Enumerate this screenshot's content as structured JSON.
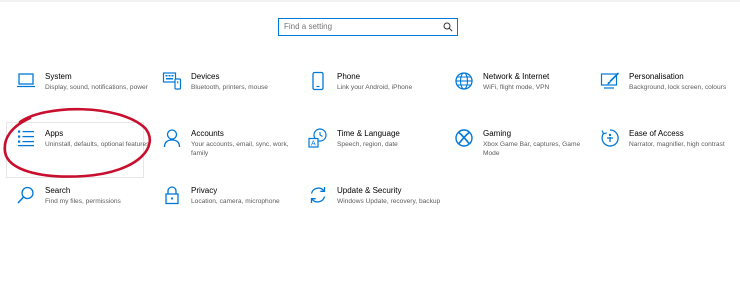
{
  "search": {
    "placeholder": "Find a setting"
  },
  "accent_color": "#0078d7",
  "annotation_color": "#c8102e",
  "tiles": [
    {
      "icon": "laptop-icon",
      "title": "System",
      "desc": "Display, sound, notifications, power"
    },
    {
      "icon": "devices-icon",
      "title": "Devices",
      "desc": "Bluetooth, printers, mouse"
    },
    {
      "icon": "phone-icon",
      "title": "Phone",
      "desc": "Link your Android, iPhone"
    },
    {
      "icon": "globe-icon",
      "title": "Network & Internet",
      "desc": "WiFi, flight mode, VPN"
    },
    {
      "icon": "paintbrush-icon",
      "title": "Personalisation",
      "desc": "Background, lock screen, colours"
    },
    {
      "icon": "apps-list-icon",
      "title": "Apps",
      "desc": "Uninstall, defaults, optional features"
    },
    {
      "icon": "person-icon",
      "title": "Accounts",
      "desc": "Your accounts, email, sync, work, family"
    },
    {
      "icon": "time-language-icon",
      "title": "Time & Language",
      "desc": "Speech, region, date"
    },
    {
      "icon": "xbox-icon",
      "title": "Gaming",
      "desc": "Xbox Game Bar, captures, Game Mode"
    },
    {
      "icon": "ease-of-access-icon",
      "title": "Ease of Access",
      "desc": "Narrator, magnifier, high contrast"
    },
    {
      "icon": "search-icon",
      "title": "Search",
      "desc": "Find my files, permissions"
    },
    {
      "icon": "lock-icon",
      "title": "Privacy",
      "desc": "Location, camera, microphone"
    },
    {
      "icon": "sync-icon",
      "title": "Update & Security",
      "desc": "Windows Update, recovery, backup"
    }
  ]
}
